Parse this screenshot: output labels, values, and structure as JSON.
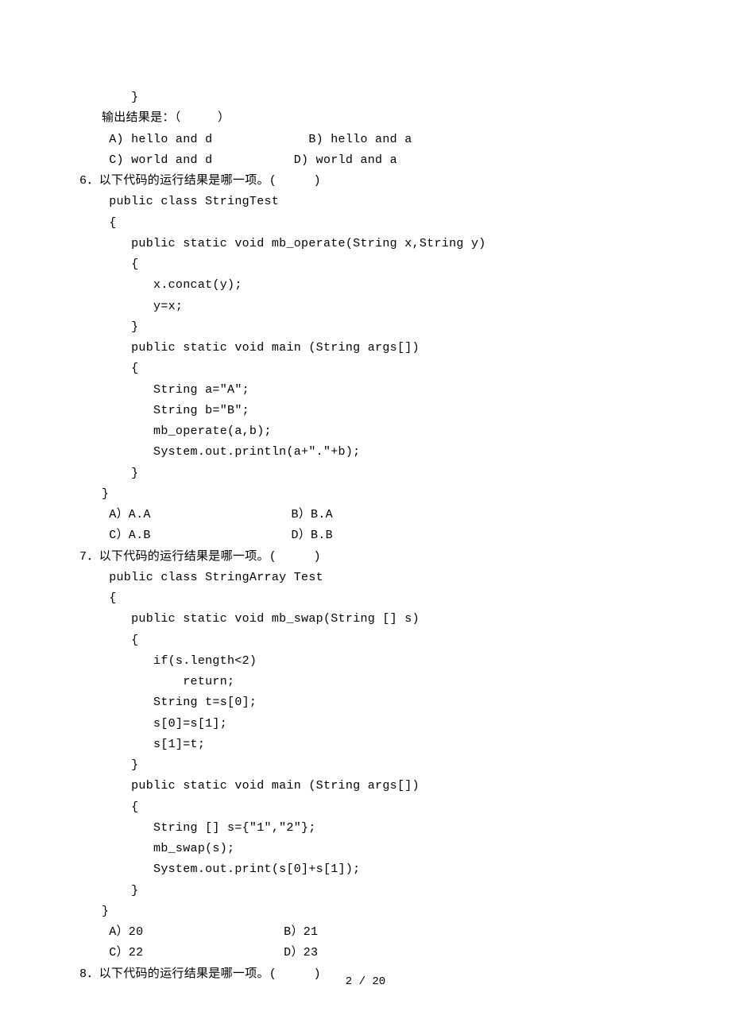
{
  "lines": {
    "l01": "       }",
    "l02": "   输出结果是：（     ）",
    "l03": "    A) hello and d             B) hello and a",
    "l04": "    C) world and d           D) world and a",
    "l05": "6．以下代码的运行结果是哪一项。(     )",
    "l06": "    public class StringTest",
    "l07": "    {",
    "l08": "       public static void mb_operate(String x,String y)",
    "l09": "       {",
    "l10": "          x.concat(y);",
    "l11": "          y=x;",
    "l12": "       }",
    "l13": "       public static void main (String args[])",
    "l14": "       {",
    "l15": "          String a=\"A\";",
    "l16": "          String b=\"B\";",
    "l17": "          mb_operate(a,b);",
    "l18": "          System.out.println(a+\".\"+b);",
    "l19": "       }",
    "l20": "   }",
    "l21": "    A）A.A                   B）B.A",
    "l22": "    C）A.B                   D）B.B",
    "l23": "7．以下代码的运行结果是哪一项。(     )",
    "l24": "    public class StringArray Test",
    "l25": "    {",
    "l26": "       public static void mb_swap(String [] s)",
    "l27": "       {",
    "l28": "          if(s.length<2)",
    "l29": "              return;",
    "l30": "          String t=s[0];",
    "l31": "          s[0]=s[1];",
    "l32": "          s[1]=t;",
    "l33": "       }",
    "l34": "       public static void main (String args[])",
    "l35": "       {",
    "l36": "          String [] s={\"1\",\"2\"};",
    "l37": "          mb_swap(s);",
    "l38": "          System.out.print(s[0]+s[1]);",
    "l39": "       }",
    "l40": "   }",
    "l41": "    A）20                   B）21",
    "l42": "    C）22                   D）23",
    "l43": "8．以下代码的运行结果是哪一项。(     )"
  },
  "footer": "2 / 20"
}
